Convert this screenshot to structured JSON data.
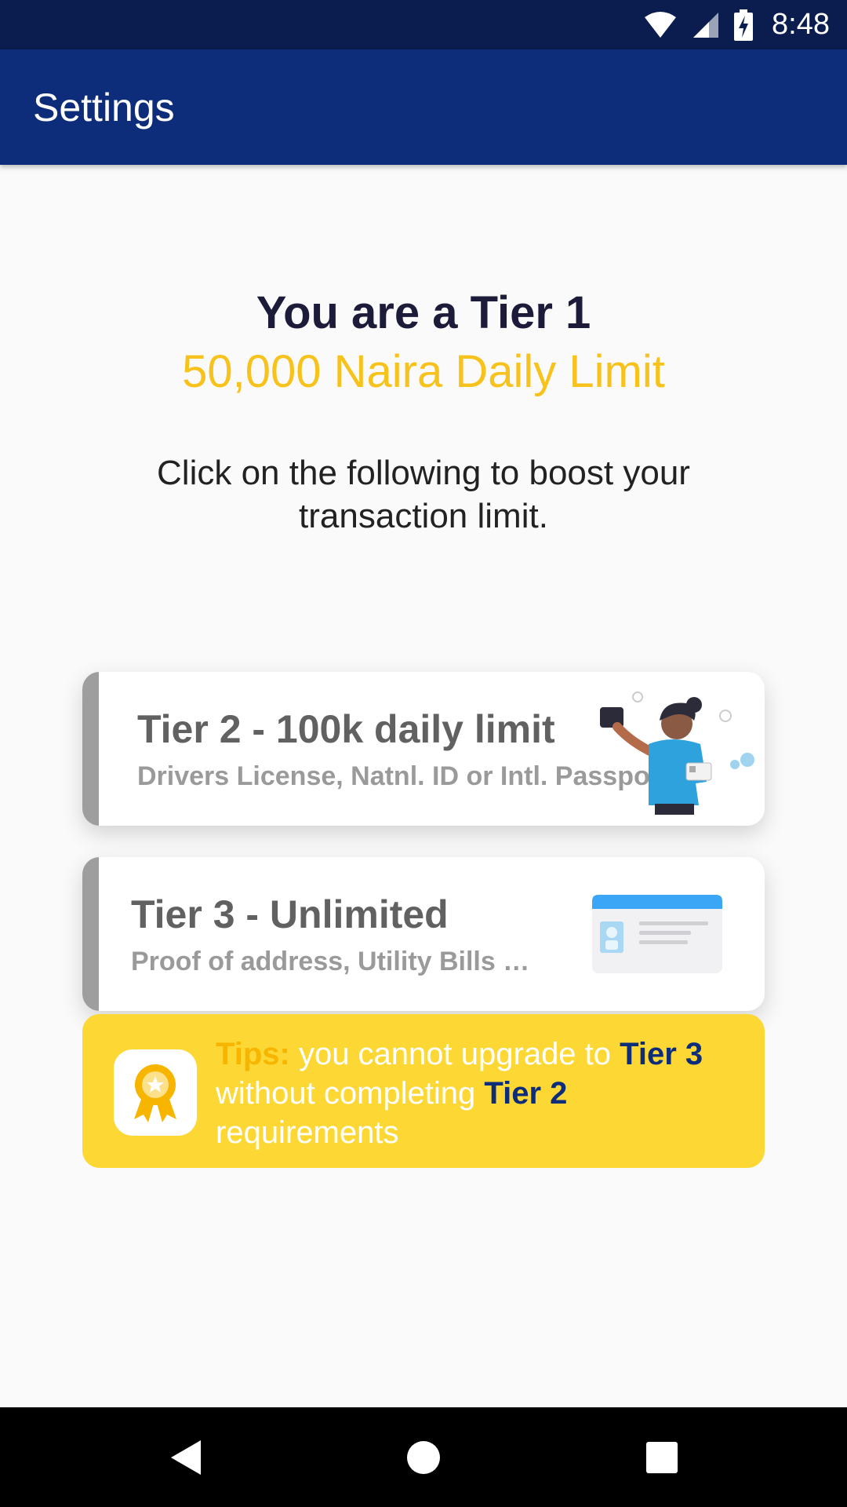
{
  "status_bar": {
    "time": "8:48",
    "icons": [
      "wifi-icon",
      "cellular-signal-icon",
      "battery-charging-icon"
    ]
  },
  "app_bar": {
    "title": "Settings"
  },
  "header": {
    "tier_line": "You are a Tier 1",
    "limit_line": "50,000 Naira Daily Limit",
    "instruction": "Click on the following to boost your transaction limit."
  },
  "cards": [
    {
      "title": "Tier 2 - 100k daily limit",
      "subtitle": "Drivers License, Natnl. ID or Intl. Passpo",
      "illustration": "person-holding-id-illustration"
    },
    {
      "title": "Tier 3 - Unlimited",
      "subtitle": "Proof of address, Utility Bills …",
      "illustration": "id-card-illustration"
    }
  ],
  "tips": {
    "label": "Tips:",
    "text_1": " you cannot upgrade to ",
    "tier_a": "Tier 3",
    "text_2": " without completing ",
    "tier_b": "Tier 2",
    "text_3": " requirements",
    "icon": "award-ribbon-icon"
  },
  "nav_bar": {
    "buttons": [
      "back-icon",
      "home-icon",
      "recents-icon"
    ]
  },
  "colors": {
    "status_bar": "#0b1d4f",
    "app_bar": "#0d2d7a",
    "accent_yellow": "#f7c21b",
    "tips_background": "#fdd835"
  }
}
